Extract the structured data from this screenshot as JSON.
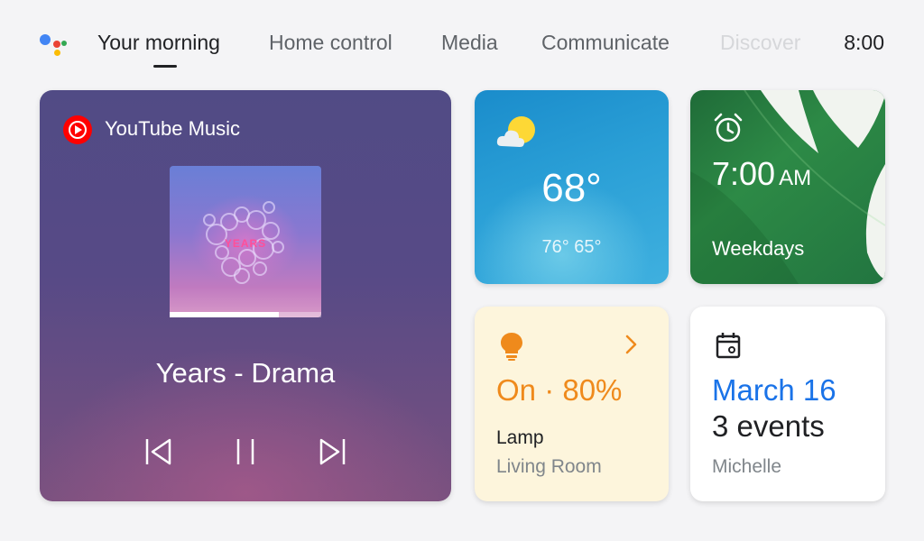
{
  "header": {
    "tabs": [
      {
        "label": "Your morning",
        "active": true
      },
      {
        "label": "Home control",
        "active": false
      },
      {
        "label": "Media",
        "active": false
      },
      {
        "label": "Communicate",
        "active": false
      },
      {
        "label": "Discover",
        "active": false
      }
    ],
    "time": "8:00"
  },
  "music": {
    "source": "YouTube Music",
    "album_text": "YEARS",
    "song": "Years - Drama",
    "progress_fraction": 0.72,
    "controls": [
      "skip-previous-icon",
      "pause-icon",
      "skip-next-icon"
    ]
  },
  "weather": {
    "temperature": "68°",
    "range": "76° 65°",
    "icon": "partly-cloudy-icon"
  },
  "alarm": {
    "time": "7:00",
    "period": "AM",
    "repeat": "Weekdays",
    "icon": "alarm-clock-icon"
  },
  "lamp": {
    "status": "On · 80%",
    "name": "Lamp",
    "room": "Living Room",
    "icon": "lightbulb-icon",
    "accent": "#ef8a1c"
  },
  "calendar": {
    "date": "March 16",
    "events": "3 events",
    "user": "Michelle",
    "icon": "calendar-icon",
    "accent": "#1a73e8"
  },
  "colors": {
    "background": "#f4f4f6",
    "text_primary": "#202124",
    "text_secondary": "#5f6368"
  }
}
